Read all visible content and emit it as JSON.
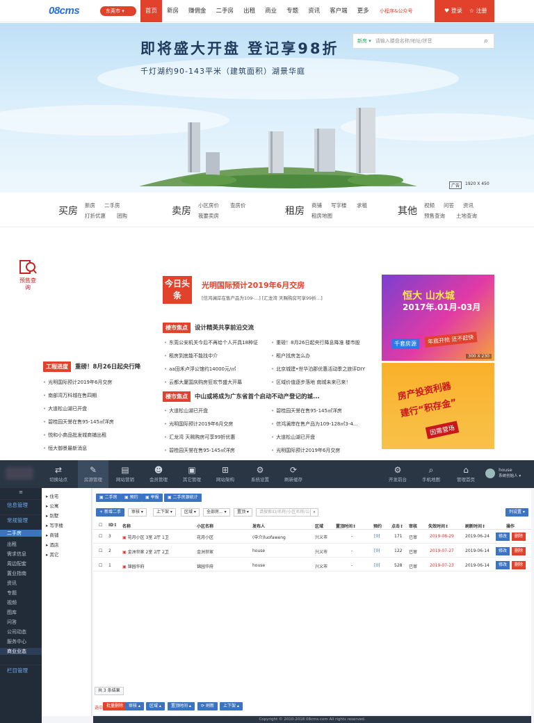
{
  "topnav": {
    "logo": "08cms",
    "city": "东莞市",
    "items": [
      "首页",
      "新房",
      "赚佣金",
      "二手房",
      "出租",
      "商业",
      "专题",
      "资讯",
      "客户端",
      "更多"
    ],
    "mini": "小程序&公众号",
    "login": "登录",
    "register": "注册"
  },
  "banner": {
    "title": "即将盛大开盘  登记享98折",
    "subtitle": "千灯湖约90-143平米（建筑面积）湖景华庭",
    "search_tab": "新房",
    "search_placeholder": "请输入楼盘名称/地址/拼音",
    "ad_badge": "广告",
    "ad_size": "1920 X 450"
  },
  "categories": [
    {
      "name": "买房",
      "l1": [
        "新房",
        "二手房"
      ],
      "l2": [
        "打折优惠",
        "团购"
      ]
    },
    {
      "name": "卖房",
      "l1": [
        "小区房价",
        "查房价"
      ],
      "l2": [
        "我要卖房"
      ]
    },
    {
      "name": "租房",
      "l1": [
        "商铺",
        "写字楼",
        "求租"
      ],
      "l2": [
        "租房地图"
      ]
    },
    {
      "name": "其他",
      "l1": [
        "视频",
        "问答",
        "资讯"
      ],
      "l2": [
        "预售查询",
        "土地查询"
      ]
    }
  ],
  "news": {
    "presale_icon": "预售查询",
    "today_badge": "今日头条",
    "today_title": "光明国际预计2019年6月交房",
    "today_sub": "[信鸿澜岸在售产品为109-…]  [汇龙湾 天赐购房可享99折…]",
    "market1_badge": "楼市焦点",
    "market1_title": "设计精英共享前沿交流",
    "market1_left": [
      "东莞公安机关今后不再给个人开具18种证",
      "租房到底能不能找中介",
      "aa田禾卢浮公馆约14000元/㎡",
      "云都大厦国庆购房狂欢节盛大开幕"
    ],
    "market1_right": [
      "重磅！8月26日起央行降息降准 楼市股",
      "租户找房怎么办",
      "北京城建•世华泊郡优惠活动季之旅评DIY",
      "区域价值逐步落地 南城未来已来！"
    ],
    "market2_badge": "楼市焦点",
    "market2_title": "中山或将成为广东省首个启动不动产登记的城...",
    "market2_left": [
      "大道松山湖已开盘",
      "光明国际预计2019年6月交房",
      "汇龙湾 天赐购房可享99折优惠",
      "碧桂园天誉在售95-145㎡洋房"
    ],
    "market2_right": [
      "碧桂园天誉在售95-145㎡洋房",
      "信鸿澜岸在售产品为109-128㎡3-4...",
      "大道松山湖已开盘",
      "光明国际预计2019年6月交房"
    ],
    "eng_badge": "工程进度",
    "eng_title": "重磅！8月26日起央行降",
    "eng_list": [
      "光明国际预计2019年6月交房",
      "南部湾万科城在售四期",
      "大道松山湖已开盘",
      "碧桂园天誉在售95-145㎡洋房",
      "悦和小商品批发城商铺出租",
      "恒大御景最新消息"
    ]
  },
  "ads": {
    "ad1_line1": "恒大 山水城",
    "ad1_line2": "2017年.01月-03月",
    "ad1_tag1": "千套房源",
    "ad1_tag2": "年底开抢 还不赶快",
    "ad1_size": "300 X 230",
    "ad2_line1": "房产投资利器",
    "ad2_line2": "建行“积存金”",
    "ad2_line3": "因需营场"
  },
  "admin": {
    "top_items": [
      "切换站点",
      "房源管理",
      "网站营销",
      "会员管理",
      "其它管理",
      "网站架构",
      "系统设置",
      "刷新缓存"
    ],
    "right_items": [
      "开发前台",
      "手机地图",
      "管理首页"
    ],
    "user": "house",
    "user_role": "系统创始人 ▾",
    "aside_head1": "信息管理",
    "aside_head2": "常规管理",
    "aside_items": [
      "二手房",
      "出租",
      "需求信息",
      "周边配套",
      "置业指南",
      "资讯",
      "专题",
      "视频",
      "图库",
      "问答",
      "公司动态",
      "服务中心",
      "商业业态"
    ],
    "aside_head3": "栏目管理",
    "tree": [
      "住宅",
      "公寓",
      "别墅",
      "写字楼",
      "商铺",
      "酒店",
      "其它"
    ],
    "tabs": [
      "二手房",
      "预约",
      "举报",
      "二手房源统计"
    ],
    "filters": [
      "新增二手",
      "审核 ▾",
      "上下架 ▾",
      "区域 ▾",
      "全部房... ▾",
      "置顶 ▾"
    ],
    "search_placeholder": "请搜索ID/名称/小区名称/公",
    "list_settings": "列设置 ▾",
    "columns": [
      "ID↕",
      "名称",
      "小区名称",
      "发布人",
      "区域",
      "置顶时间↕",
      "预约",
      "点击↕",
      "审核",
      "失效时间↕",
      "刷新时间↕",
      "操作"
    ],
    "rows": [
      {
        "id": "3",
        "name": "花月小区 3室 2厅 1卫",
        "community": "花月小区",
        "publisher": "(中介)luofaweng",
        "area": "兴义市",
        "top": "-",
        "appoint": "[0]",
        "clicks": "171",
        "status": "已审",
        "expire": "2019-08-29",
        "refresh": "2019-06-24"
      },
      {
        "id": "2",
        "name": "金洲世家 2室 2厅 2卫",
        "community": "金洲世家",
        "publisher": "house",
        "area": "兴义市",
        "top": "-",
        "appoint": "[0]",
        "clicks": "122",
        "status": "已审",
        "expire": "2019-07-27",
        "refresh": "2019-06-14"
      },
      {
        "id": "1",
        "name": "锦园华府",
        "community": "锦园华府",
        "publisher": "house",
        "area": "兴义市",
        "top": "-",
        "appoint": "[0]",
        "clicks": "528",
        "status": "已审",
        "expire": "2019-07-23",
        "refresh": "2019-06-14"
      }
    ],
    "edit": "修改",
    "delete": "删除",
    "total": "共 3 条结果",
    "bottom_actions": [
      "批量删除",
      "审核 ▴",
      "区域 ▴",
      "置顶时间 ▴",
      "刷新",
      "上下架 ▴"
    ],
    "bottom_prefix": "选中:",
    "footer": "Copyright © 2010-2018 08cms.com All rights reserved."
  }
}
